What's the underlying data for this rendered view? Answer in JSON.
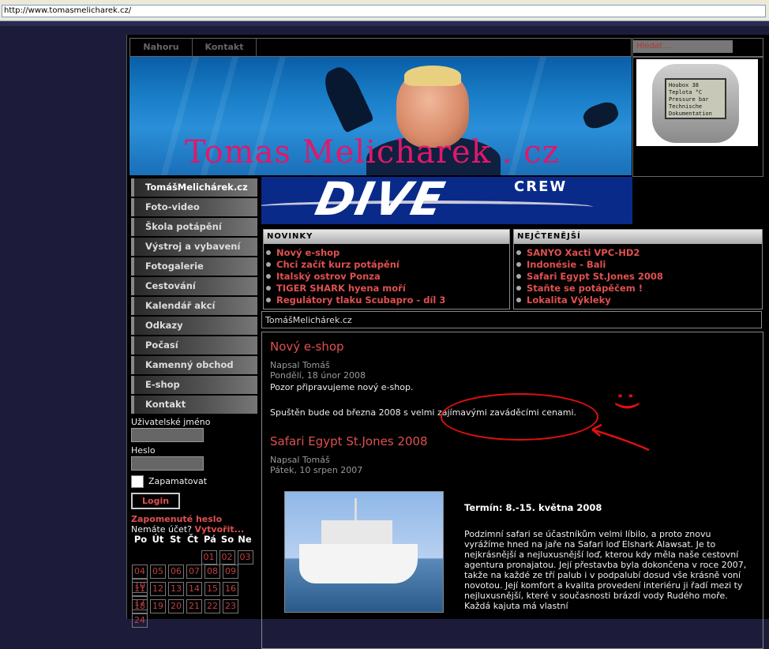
{
  "browser": {
    "url": "http://www.tomasmelicharek.cz/"
  },
  "topnav": {
    "items": [
      "Nahoru",
      "Kontakt"
    ]
  },
  "topright": {
    "label": "Hledat ..."
  },
  "banner": {
    "title": "Tomas Melicharek . cz"
  },
  "device": {
    "lines": [
      "Houbox 38",
      "Teplota °C",
      "Pressure bar",
      "Technische Dokumentation"
    ]
  },
  "logo": {
    "dive": "DIVE",
    "crew": "CREW"
  },
  "sidebar": {
    "items": [
      "TomášMelichárek.cz",
      "Foto-video",
      "Škola potápění",
      "Výstroj a vybavení",
      "Fotogalerie",
      "Cestování",
      "Kalendář akcí",
      "Odkazy",
      "Počasí",
      "Kamenný obchod",
      "E-shop",
      "Kontakt"
    ]
  },
  "login": {
    "username_label": "Uživatelské jméno",
    "password_label": "Heslo",
    "remember_label": "Zapamatovat",
    "login_button": "Login",
    "forgot": "Zapomenuté heslo",
    "no_account": "Nemáte účet?",
    "create": "Vytvořit..."
  },
  "calendar": {
    "days": [
      "Po",
      "Út",
      "St",
      "Čt",
      "Pá",
      "So",
      "Ne"
    ],
    "rows": [
      [
        "",
        "",
        "",
        "",
        "01",
        "02",
        "03"
      ],
      [
        "04",
        "05",
        "06",
        "07",
        "08",
        "09",
        "10"
      ],
      [
        "11",
        "12",
        "13",
        "14",
        "15",
        "16",
        "17"
      ],
      [
        "18",
        "19",
        "20",
        "21",
        "22",
        "23",
        "24"
      ]
    ]
  },
  "novinky": {
    "heading": "NOVINKY",
    "items": [
      "Nový e-shop",
      "Chci začít kurz potápění",
      "Italský ostrov Ponza",
      "TIGER SHARK hyena moří",
      "Regulátory tlaku Scubapro - díl 3"
    ]
  },
  "nejctenejsi": {
    "heading": "NEJČTENĚJŠÍ",
    "items": [
      "SANYO Xacti VPC-HD2",
      "Indonésie - Bali",
      "Safari Egypt St.Jones 2008",
      "Staňte se potápěčem !",
      "Lokalita Výkleky"
    ]
  },
  "breadcrumb": "TomášMelichárek.cz",
  "articles": [
    {
      "title": "Nový e-shop",
      "author": "Napsal Tomáš",
      "date": "Pondělí, 18 únor 2008",
      "p1": "Pozor připravujeme nový e-shop.",
      "p2": "Spuštěn bude od března 2008 s velmi zajímavými zaváděcími cenami."
    },
    {
      "title": "Safari Egypt St.Jones 2008",
      "author": "Napsal Tomáš",
      "date": "Pátek, 10 srpen 2007",
      "term": "Termín: 8.-15. května 2008",
      "para": "Podzimní safari se účastníkům velmi líbilo, a proto znovu vyrážíme hned na jaře na Safari loď Elshark Alawsat. Je to nejkrásnější a nejluxusnější loď, kterou kdy měla naše cestovní agentura pronajatou. Její přestavba byla dokončena v roce 2007, takže na každé ze tří palub i v podpalubí dosud vše krásně voní novotou. Její komfort a kvalita provedení interiéru ji řadí mezi ty nejluxusnější, které v současnosti brázdí vody Rudého moře. Každá kajuta má vlastní"
    }
  ],
  "annotation": {
    "smiley": ":)",
    "color": "#e01010"
  }
}
